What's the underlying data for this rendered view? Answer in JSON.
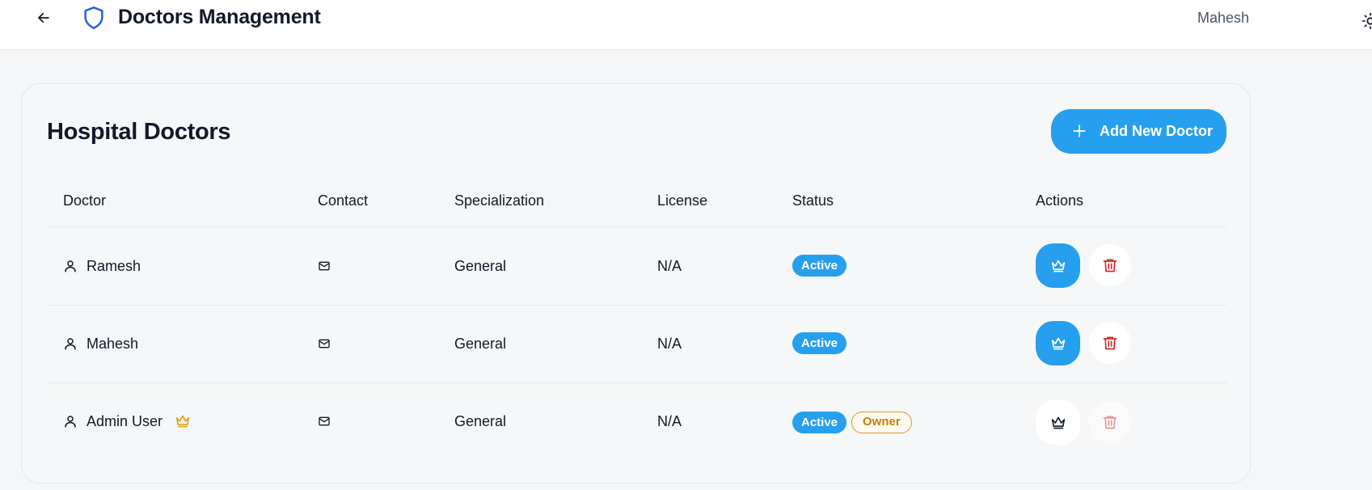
{
  "header": {
    "title": "Doctors Management",
    "user": "Mahesh"
  },
  "card": {
    "title": "Hospital Doctors",
    "add_button": "Add New Doctor"
  },
  "table": {
    "columns": [
      "Doctor",
      "Contact",
      "Specialization",
      "License",
      "Status",
      "Actions"
    ],
    "rows": [
      {
        "name": "Ramesh",
        "specialization": "General",
        "license": "N/A",
        "status": "Active",
        "owner": ""
      },
      {
        "name": "Mahesh",
        "specialization": "General",
        "license": "N/A",
        "status": "Active",
        "owner": ""
      },
      {
        "name": "Admin User",
        "specialization": "General",
        "license": "N/A",
        "status": "Active",
        "owner": "Owner"
      }
    ]
  },
  "colors": {
    "accent": "#26a0ee",
    "danger": "#dc2626",
    "owner": "#d79a2b",
    "shield": "#2563eb"
  },
  "icons": {
    "back": "arrow-left-icon",
    "brand": "shield-icon",
    "theme": "sun-icon",
    "add": "plus-icon",
    "doctor": "user-icon",
    "contact": "mail-icon",
    "admin": "crown-icon",
    "delete": "trash-icon"
  }
}
